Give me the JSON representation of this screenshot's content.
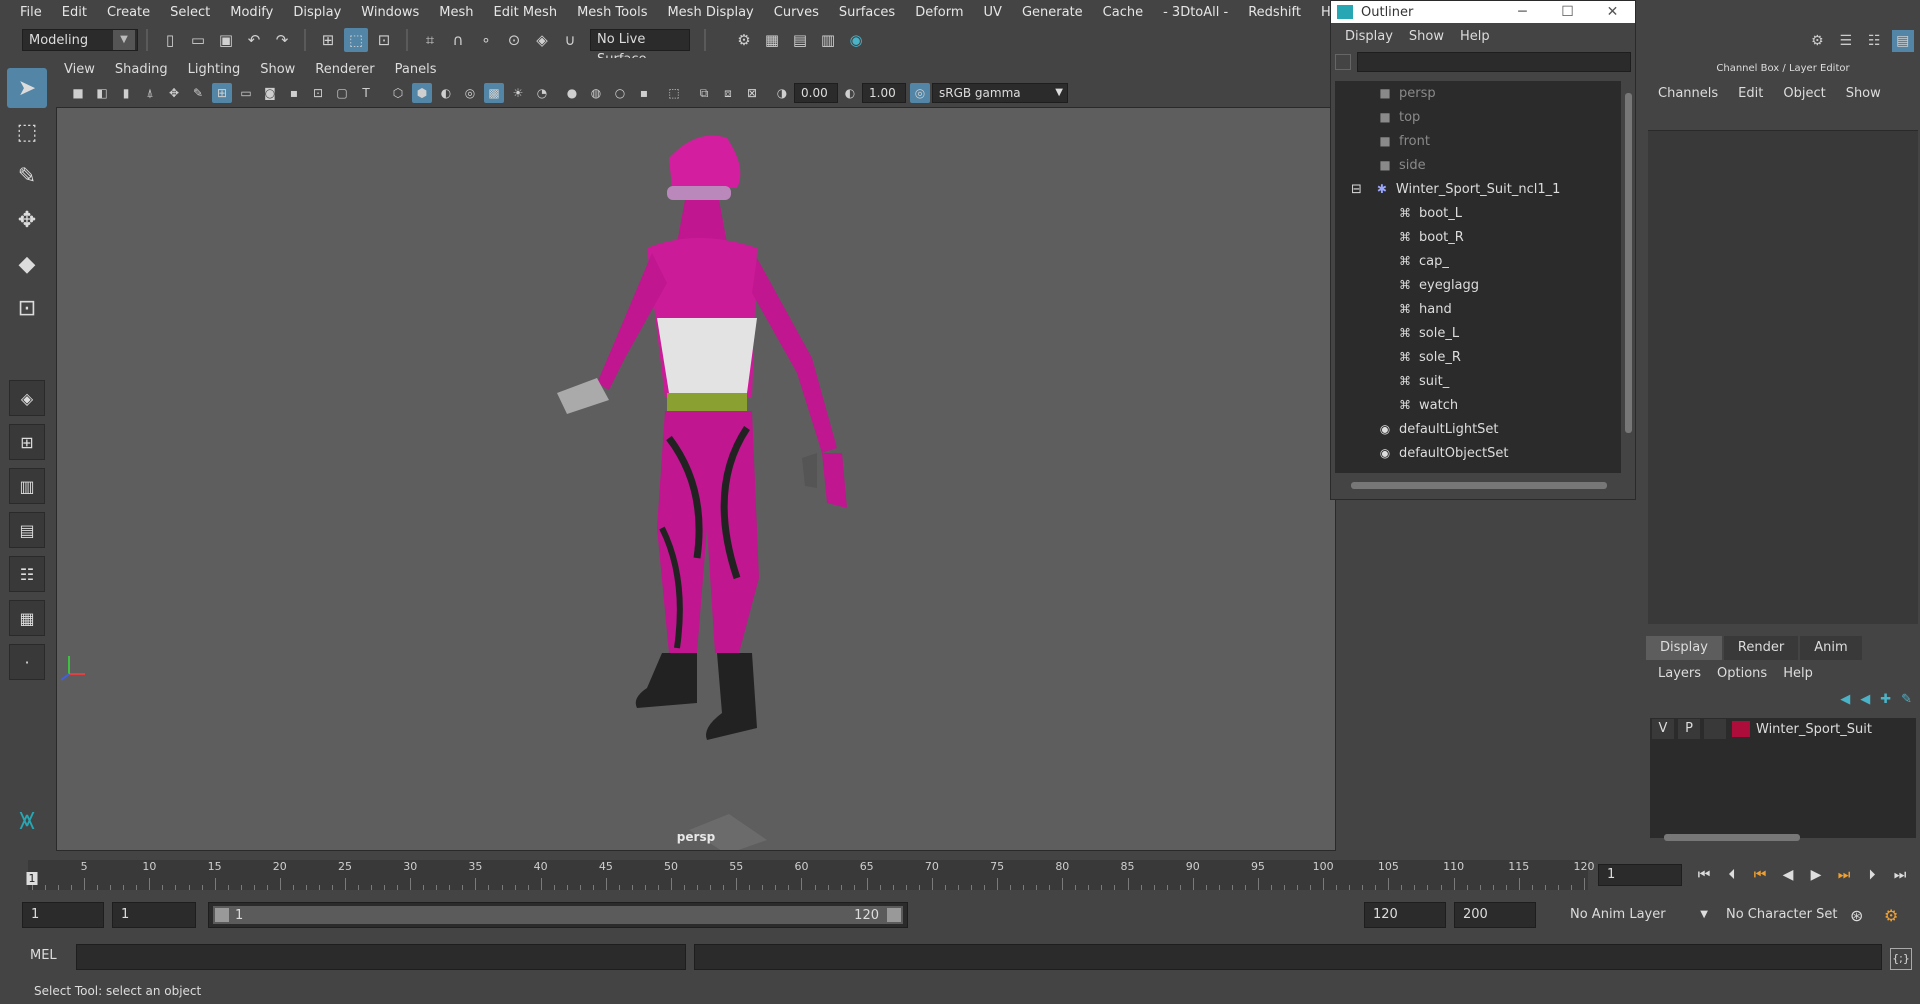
{
  "menubar": {
    "items": [
      "File",
      "Edit",
      "Create",
      "Select",
      "Modify",
      "Display",
      "Windows",
      "Mesh",
      "Edit Mesh",
      "Mesh Tools",
      "Mesh Display",
      "Curves",
      "Surfaces",
      "Deform",
      "UV",
      "Generate",
      "Cache",
      "- 3DtoAll -",
      "Redshift",
      "Help"
    ]
  },
  "toolbar": {
    "mode": "Modeling",
    "live_surface": "No Live Surface"
  },
  "panel": {
    "menu": [
      "View",
      "Shading",
      "Lighting",
      "Show",
      "Renderer",
      "Panels"
    ],
    "exposure": "0.00",
    "gamma": "1.00",
    "color_space": "sRGB gamma",
    "camera_label": "persp"
  },
  "outliner": {
    "title": "Outliner",
    "menu": [
      "Display",
      "Show",
      "Help"
    ],
    "cameras": [
      "persp",
      "top",
      "front",
      "side"
    ],
    "group": "Winter_Sport_Suit_ncl1_1",
    "children": [
      "boot_L",
      "boot_R",
      "cap_",
      "eyeglagg",
      "hand",
      "sole_L",
      "sole_R",
      "suit_",
      "watch"
    ],
    "sets": [
      "defaultLightSet",
      "defaultObjectSet"
    ]
  },
  "channelbox": {
    "title": "Channel Box / Layer Editor",
    "menu": [
      "Channels",
      "Edit",
      "Object",
      "Show"
    ]
  },
  "layers": {
    "tabs": [
      "Display",
      "Render",
      "Anim"
    ],
    "menu": [
      "Layers",
      "Options",
      "Help"
    ],
    "layer": {
      "v": "V",
      "p": "P",
      "name": "Winter_Sport_Suit",
      "color": "#ad0d3a"
    }
  },
  "timeslider": {
    "ticks": [
      "5",
      "10",
      "15",
      "20",
      "25",
      "30",
      "35",
      "40",
      "45",
      "50",
      "55",
      "60",
      "65",
      "70",
      "75",
      "80",
      "85",
      "90",
      "95",
      "100",
      "105",
      "110",
      "115",
      "120"
    ],
    "start_label": "1",
    "current_frame": "1"
  },
  "rangeslider": {
    "start": "1",
    "anim_start": "1",
    "range_start": "1",
    "range_end": "120",
    "end": "120",
    "anim_end": "200",
    "anim_layer": "No Anim Layer",
    "char_set": "No Character Set"
  },
  "cmdline": {
    "label": "MEL"
  },
  "helpline": {
    "text": "Select Tool: select an object"
  }
}
